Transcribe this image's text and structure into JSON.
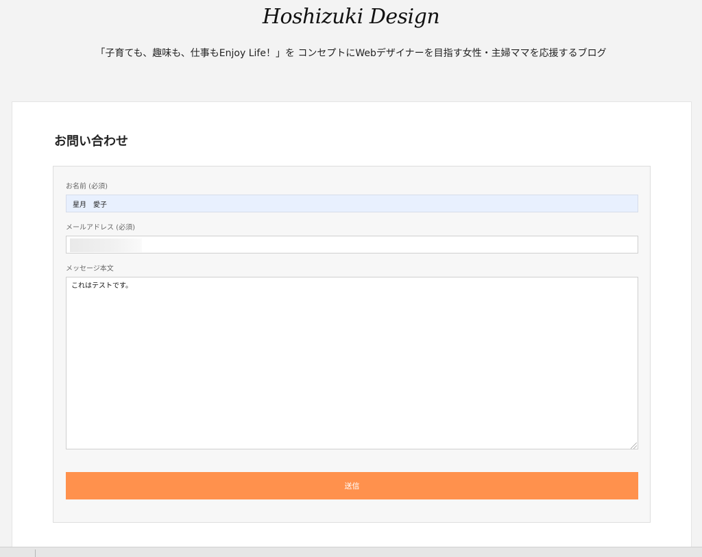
{
  "header": {
    "logo_text": "Hoshizuki Design",
    "tagline": "「子育ても、趣味も、仕事もEnjoy Life！」を コンセプトにWebデザイナーを目指す女性・主婦ママを応援するブログ"
  },
  "page": {
    "title": "お問い合わせ"
  },
  "form": {
    "name_label": "お名前 (必須)",
    "name_value": "星月　愛子",
    "email_label": "メールアドレス (必須)",
    "email_value": "",
    "message_label": "メッセージ本文",
    "message_value": "これはテストです。",
    "submit_label": "送信"
  },
  "colors": {
    "page_background": "#f3f3f3",
    "submit_button": "#ff914d",
    "autofill_background": "#e8f0fe"
  }
}
